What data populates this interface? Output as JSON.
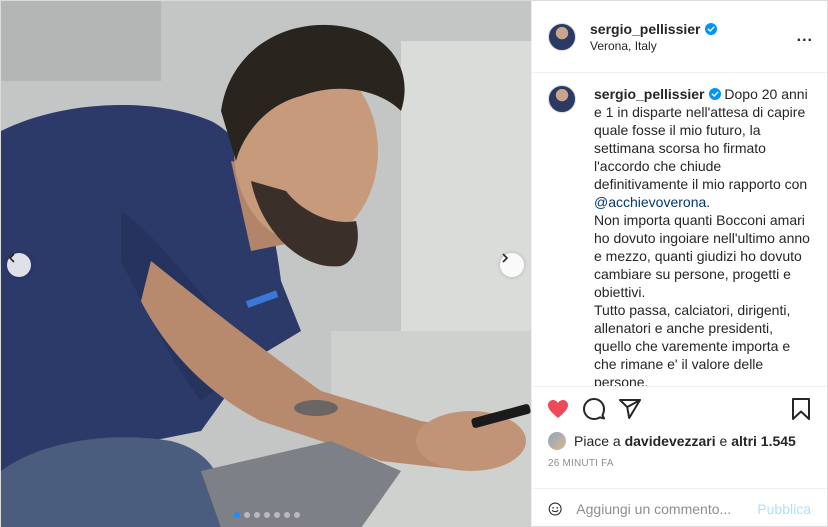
{
  "header": {
    "username": "sergio_pellissier",
    "location": "Verona, Italy",
    "more_label": "..."
  },
  "caption": {
    "username": "sergio_pellissier",
    "text_before_mention": " Dopo 20 anni e 1 in disparte nell'attesa di capire quale fosse il mio futuro, la settimana scorsa ho firmato l'accordo che chiude definitivamente il mio rapporto con ",
    "mention": "@acchievoverona",
    "text_after_mention": ".\nNon importa quanti Bocconi amari ho dovuto ingoiare nell'ultimo anno e mezzo, quanti giudizi ho dovuto cambiare su persone, progetti e obiettivi.\nTutto passa, calciatori, dirigenti, allenatori e anche presidenti, quello che varemente importa e che rimane e' il valore delle persone.\nCredo di aver dato a questa società tutto quello che potevo dare. Non sarei mai potuto restare e percepire"
  },
  "likes": {
    "prefix": "Piace a ",
    "user": "davidevezzari",
    "middle": " e ",
    "others": "altri 1.545"
  },
  "time": "26 MINUTI FA",
  "comment": {
    "placeholder": "Aggiungi un commento...",
    "publish_label": "Pubblica"
  },
  "carousel": {
    "dot_count": 7,
    "active_index": 0
  },
  "colors": {
    "like_red": "#ed4956",
    "verified_blue": "#0095f6",
    "publish_disabled": "#b2dffc",
    "mention": "#00376b",
    "shirt_navy": "#2c3a6a"
  },
  "icons": {
    "like": "heart-icon",
    "comment": "comment-icon",
    "share": "share-icon",
    "save": "bookmark-icon",
    "emoji": "emoji-icon",
    "prev": "chevron-left-icon",
    "next": "chevron-right-icon"
  }
}
